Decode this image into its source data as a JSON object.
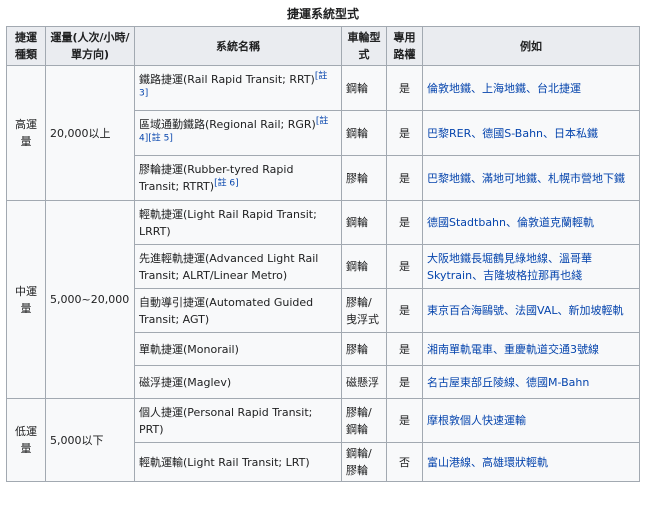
{
  "table": {
    "caption": "捷運系統型式",
    "headers": {
      "type": "捷運種類",
      "capacity": "運量(人次/小時/單方向)",
      "system": "系統名稱",
      "wheel": "車輪型式",
      "row": "專用路權",
      "example": "例如"
    },
    "groups": [
      {
        "type": "高運量",
        "capacity": "20,000以上",
        "rows": [
          {
            "name": "鐵路捷運(Rail Rapid Transit; RRT)",
            "refs": [
              "[註 3]"
            ],
            "wheel": "鋼輪",
            "row": "是",
            "example": "倫敦地鐵、上海地鐵、台北捷運"
          },
          {
            "name": "區域通勤鐵路(Regional Rail; RGR)",
            "refs": [
              "[註 4]",
              "[註 5]"
            ],
            "wheel": "鋼輪",
            "row": "是",
            "example": "巴黎RER、德國S-Bahn、日本私鐵"
          },
          {
            "name": "膠輪捷運(Rubber-tyred Rapid Transit; RTRT)",
            "refs": [
              "[註 6]"
            ],
            "wheel": "膠輪",
            "row": "是",
            "example": "巴黎地鐵、滿地可地鐵、札幌市營地下鐵"
          }
        ]
      },
      {
        "type": "中運量",
        "capacity": "5,000~20,000",
        "rows": [
          {
            "name": "輕軌捷運(Light Rail Rapid Transit; LRRT)",
            "refs": [],
            "wheel": "鋼輪",
            "row": "是",
            "example": "德國Stadtbahn、倫敦道克蘭輕軌"
          },
          {
            "name": "先進輕軌捷運(Advanced Light Rail Transit; ALRT/Linear Metro)",
            "refs": [],
            "wheel": "鋼輪",
            "row": "是",
            "example": "大阪地鐵長堀鶴見綠地線、溫哥華Skytrain、吉隆坡格拉那再也綫"
          },
          {
            "name": "自動導引捷運(Automated Guided Transit; AGT)",
            "refs": [],
            "wheel": "膠輪/曳浮式",
            "row": "是",
            "example": "東京百合海鷗號、法國VAL、新加坡輕軌"
          },
          {
            "name": "單軌捷運(Monorail)",
            "refs": [],
            "wheel": "膠輪",
            "row": "是",
            "example": "湘南單軌電車、重慶軌道交通3號線"
          },
          {
            "name": "磁浮捷運(Maglev)",
            "refs": [],
            "wheel": "磁懸浮",
            "row": "是",
            "example": "名古屋東部丘陵線、德國M-Bahn"
          }
        ]
      },
      {
        "type": "低運量",
        "capacity": "5,000以下",
        "rows": [
          {
            "name": "個人捷運(Personal Rapid Transit; PRT)",
            "refs": [],
            "wheel": "膠輪/鋼輪",
            "row": "是",
            "example": "摩根敦個人快速運輸"
          },
          {
            "name": "輕軌運輸(Light Rail Transit; LRT)",
            "refs": [],
            "wheel": "鋼輪/膠輪",
            "row": "否",
            "example": "富山港線、高雄環狀輕軌"
          }
        ]
      }
    ]
  }
}
